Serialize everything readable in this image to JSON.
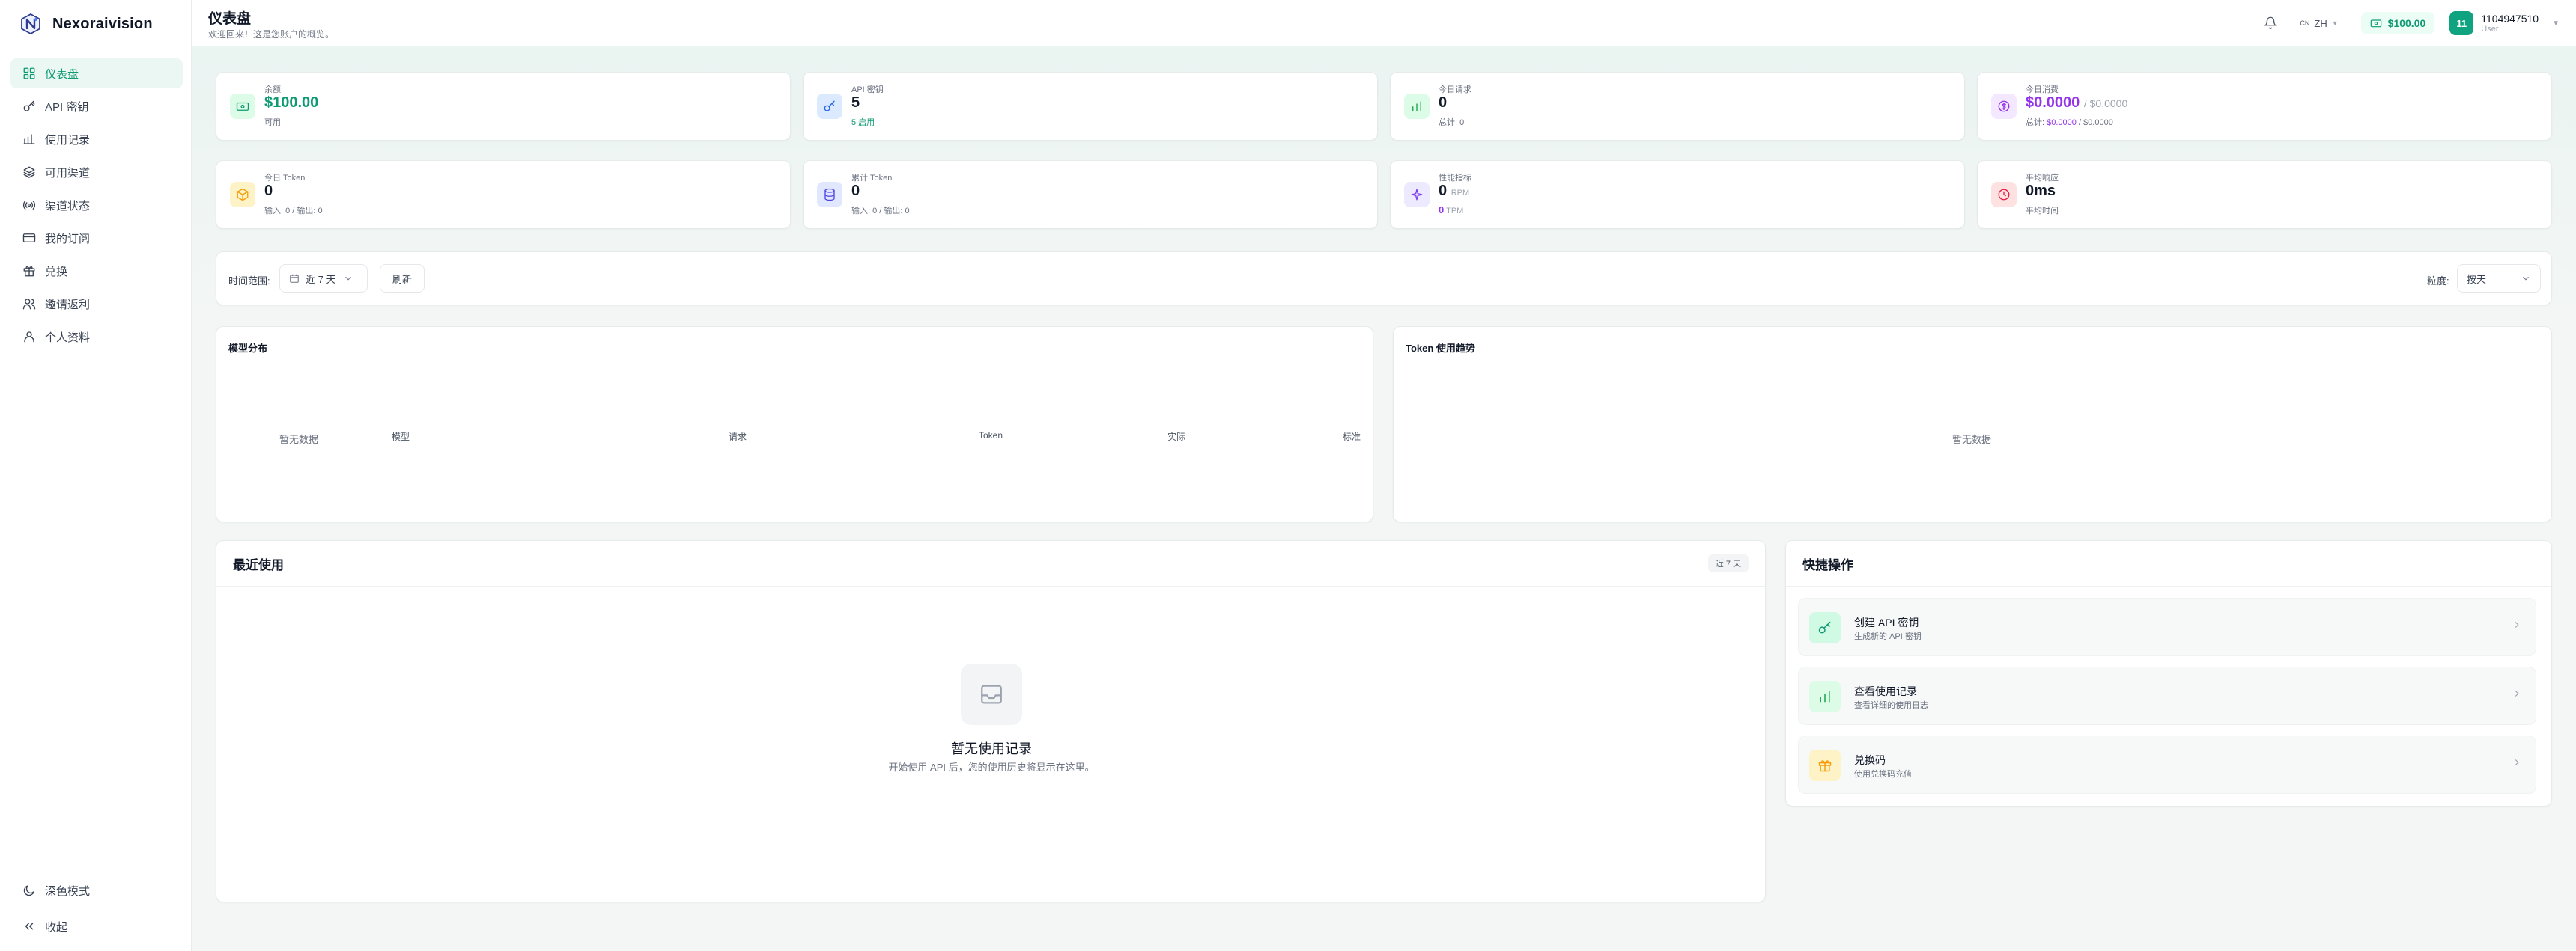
{
  "app": {
    "name": "Nexoraivision"
  },
  "sidebar": {
    "items": [
      {
        "label": "仪表盘",
        "icon": "dashboard-icon",
        "active": true
      },
      {
        "label": "API 密钥",
        "icon": "key-icon"
      },
      {
        "label": "使用记录",
        "icon": "bar-chart-icon"
      },
      {
        "label": "可用渠道",
        "icon": "layers-icon"
      },
      {
        "label": "渠道状态",
        "icon": "signal-icon"
      },
      {
        "label": "我的订阅",
        "icon": "credit-card-icon"
      },
      {
        "label": "兑换",
        "icon": "gift-icon"
      },
      {
        "label": "邀请返利",
        "icon": "users-icon"
      },
      {
        "label": "个人资料",
        "icon": "user-icon"
      }
    ],
    "dark_mode_label": "深色模式",
    "collapse_label": "收起"
  },
  "header": {
    "title": "仪表盘",
    "subtitle": "欢迎回来！这是您账户的概览。",
    "lang_code": "CN",
    "lang_label": "ZH",
    "balance": "$100.00",
    "user_initials": "11",
    "user_name": "1104947510",
    "user_role": "User"
  },
  "stats": {
    "balance": {
      "label": "余额",
      "value": "$100.00",
      "sub": "可用"
    },
    "api_keys": {
      "label": "API 密钥",
      "value": "5",
      "sub": "5 启用"
    },
    "today_requests": {
      "label": "今日请求",
      "value": "0",
      "sub": "总计: 0"
    },
    "today_cost": {
      "label": "今日消费",
      "value": "$0.0000",
      "value_extra": "/ $0.0000",
      "sub_prefix": "总计:",
      "sub_value": "$0.0000",
      "sub_suffix": "/ $0.0000"
    },
    "today_tokens": {
      "label": "今日 Token",
      "value": "0",
      "sub": "输入: 0 / 输出: 0"
    },
    "total_tokens": {
      "label": "累计 Token",
      "value": "0",
      "sub": "输入: 0 / 输出: 0"
    },
    "performance": {
      "label": "性能指标",
      "value": "0",
      "value_unit": "RPM",
      "sub_value": "0",
      "sub_unit": "TPM"
    },
    "avg_response": {
      "label": "平均响应",
      "value": "0ms",
      "sub": "平均时间"
    }
  },
  "filters": {
    "time_range_label": "时间范围:",
    "time_range_value": "近 7 天",
    "refresh_label": "刷新",
    "granularity_label": "粒度:",
    "granularity_value": "按天"
  },
  "model_distribution": {
    "title": "模型分布",
    "empty": "暂无数据",
    "columns": [
      "模型",
      "请求",
      "Token",
      "实际",
      "标准"
    ]
  },
  "token_trend": {
    "title": "Token 使用趋势",
    "empty": "暂无数据"
  },
  "recent_usage": {
    "title": "最近使用",
    "range_chip": "近 7 天",
    "empty_title": "暂无使用记录",
    "empty_desc": "开始使用 API 后，您的使用历史将显示在这里。"
  },
  "quick_actions": {
    "title": "快捷操作",
    "items": [
      {
        "title": "创建 API 密钥",
        "desc": "生成新的 API 密钥"
      },
      {
        "title": "查看使用记录",
        "desc": "查看详细的使用日志"
      },
      {
        "title": "兑换码",
        "desc": "使用兑换码充值"
      }
    ]
  },
  "colors": {
    "accent": "#0f9a73",
    "purple": "#9333ea"
  }
}
